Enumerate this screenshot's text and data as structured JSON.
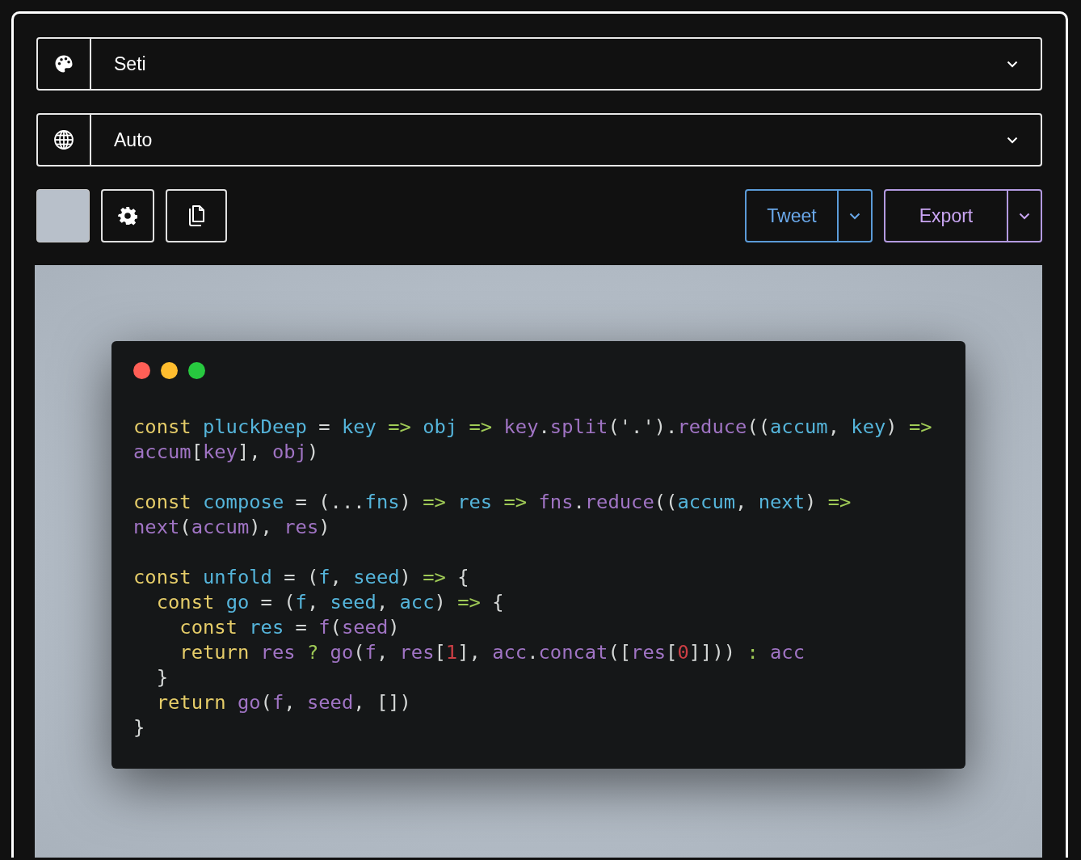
{
  "theme_select": {
    "value": "Seti"
  },
  "language_select": {
    "value": "Auto"
  },
  "toolbar": {
    "tweet_button": {
      "label": "Tweet"
    },
    "export_button": {
      "label": "Export"
    }
  },
  "code_window": {
    "blocks": [
      [
        [
          {
            "t": "const ",
            "kind": "kw"
          },
          {
            "t": "pluckDeep",
            "kind": "def"
          },
          {
            "t": " = ",
            "kind": "p"
          },
          {
            "t": "key",
            "kind": "def"
          },
          {
            "t": " => ",
            "kind": "op"
          },
          {
            "t": "obj",
            "kind": "def"
          },
          {
            "t": " => ",
            "kind": "op"
          },
          {
            "t": "key",
            "kind": "ref"
          },
          {
            "t": ".",
            "kind": "p"
          },
          {
            "t": "split",
            "kind": "ref"
          },
          {
            "t": "('.').",
            "kind": "p"
          },
          {
            "t": "reduce",
            "kind": "ref"
          },
          {
            "t": "((",
            "kind": "p"
          },
          {
            "t": "accum",
            "kind": "def"
          },
          {
            "t": ", ",
            "kind": "p"
          },
          {
            "t": "key",
            "kind": "def"
          },
          {
            "t": ") ",
            "kind": "p"
          },
          {
            "t": "=>",
            "kind": "op"
          }
        ],
        [
          {
            "t": "accum",
            "kind": "ref"
          },
          {
            "t": "[",
            "kind": "p"
          },
          {
            "t": "key",
            "kind": "ref"
          },
          {
            "t": "], ",
            "kind": "p"
          },
          {
            "t": "obj",
            "kind": "ref"
          },
          {
            "t": ")",
            "kind": "p"
          }
        ]
      ],
      [
        [
          {
            "t": "const ",
            "kind": "kw"
          },
          {
            "t": "compose",
            "kind": "def"
          },
          {
            "t": " = (...",
            "kind": "p"
          },
          {
            "t": "fns",
            "kind": "def"
          },
          {
            "t": ") ",
            "kind": "p"
          },
          {
            "t": "=> ",
            "kind": "op"
          },
          {
            "t": "res",
            "kind": "def"
          },
          {
            "t": " => ",
            "kind": "op"
          },
          {
            "t": "fns",
            "kind": "ref"
          },
          {
            "t": ".",
            "kind": "p"
          },
          {
            "t": "reduce",
            "kind": "ref"
          },
          {
            "t": "((",
            "kind": "p"
          },
          {
            "t": "accum",
            "kind": "def"
          },
          {
            "t": ", ",
            "kind": "p"
          },
          {
            "t": "next",
            "kind": "def"
          },
          {
            "t": ") ",
            "kind": "p"
          },
          {
            "t": "=>",
            "kind": "op"
          }
        ],
        [
          {
            "t": "next",
            "kind": "ref"
          },
          {
            "t": "(",
            "kind": "p"
          },
          {
            "t": "accum",
            "kind": "ref"
          },
          {
            "t": "), ",
            "kind": "p"
          },
          {
            "t": "res",
            "kind": "ref"
          },
          {
            "t": ")",
            "kind": "p"
          }
        ]
      ],
      [
        [
          {
            "t": "const ",
            "kind": "kw"
          },
          {
            "t": "unfold",
            "kind": "def"
          },
          {
            "t": " = (",
            "kind": "p"
          },
          {
            "t": "f",
            "kind": "def"
          },
          {
            "t": ", ",
            "kind": "p"
          },
          {
            "t": "seed",
            "kind": "def"
          },
          {
            "t": ") ",
            "kind": "p"
          },
          {
            "t": "=>",
            "kind": "op"
          },
          {
            "t": " {",
            "kind": "p"
          }
        ],
        [
          {
            "t": "  const ",
            "kind": "kw"
          },
          {
            "t": "go",
            "kind": "def"
          },
          {
            "t": " = (",
            "kind": "p"
          },
          {
            "t": "f",
            "kind": "def"
          },
          {
            "t": ", ",
            "kind": "p"
          },
          {
            "t": "seed",
            "kind": "def"
          },
          {
            "t": ", ",
            "kind": "p"
          },
          {
            "t": "acc",
            "kind": "def"
          },
          {
            "t": ") ",
            "kind": "p"
          },
          {
            "t": "=>",
            "kind": "op"
          },
          {
            "t": " {",
            "kind": "p"
          }
        ],
        [
          {
            "t": "    const ",
            "kind": "kw"
          },
          {
            "t": "res",
            "kind": "def"
          },
          {
            "t": " = ",
            "kind": "p"
          },
          {
            "t": "f",
            "kind": "ref"
          },
          {
            "t": "(",
            "kind": "p"
          },
          {
            "t": "seed",
            "kind": "ref"
          },
          {
            "t": ")",
            "kind": "p"
          }
        ],
        [
          {
            "t": "    return ",
            "kind": "kw"
          },
          {
            "t": "res",
            "kind": "ref"
          },
          {
            "t": " ? ",
            "kind": "op"
          },
          {
            "t": "go",
            "kind": "ref"
          },
          {
            "t": "(",
            "kind": "p"
          },
          {
            "t": "f",
            "kind": "ref"
          },
          {
            "t": ", ",
            "kind": "p"
          },
          {
            "t": "res",
            "kind": "ref"
          },
          {
            "t": "[",
            "kind": "p"
          },
          {
            "t": "1",
            "kind": "num"
          },
          {
            "t": "], ",
            "kind": "p"
          },
          {
            "t": "acc",
            "kind": "ref"
          },
          {
            "t": ".",
            "kind": "p"
          },
          {
            "t": "concat",
            "kind": "ref"
          },
          {
            "t": "([",
            "kind": "p"
          },
          {
            "t": "res",
            "kind": "ref"
          },
          {
            "t": "[",
            "kind": "p"
          },
          {
            "t": "0",
            "kind": "num"
          },
          {
            "t": "]])) ",
            "kind": "p"
          },
          {
            "t": ": ",
            "kind": "op"
          },
          {
            "t": "acc",
            "kind": "ref"
          }
        ],
        [
          {
            "t": "  }",
            "kind": "p"
          }
        ],
        [
          {
            "t": "  return ",
            "kind": "kw"
          },
          {
            "t": "go",
            "kind": "ref"
          },
          {
            "t": "(",
            "kind": "p"
          },
          {
            "t": "f",
            "kind": "ref"
          },
          {
            "t": ", ",
            "kind": "p"
          },
          {
            "t": "seed",
            "kind": "ref"
          },
          {
            "t": ", [])",
            "kind": "p"
          }
        ],
        [
          {
            "t": "}",
            "kind": "p"
          }
        ]
      ]
    ]
  }
}
